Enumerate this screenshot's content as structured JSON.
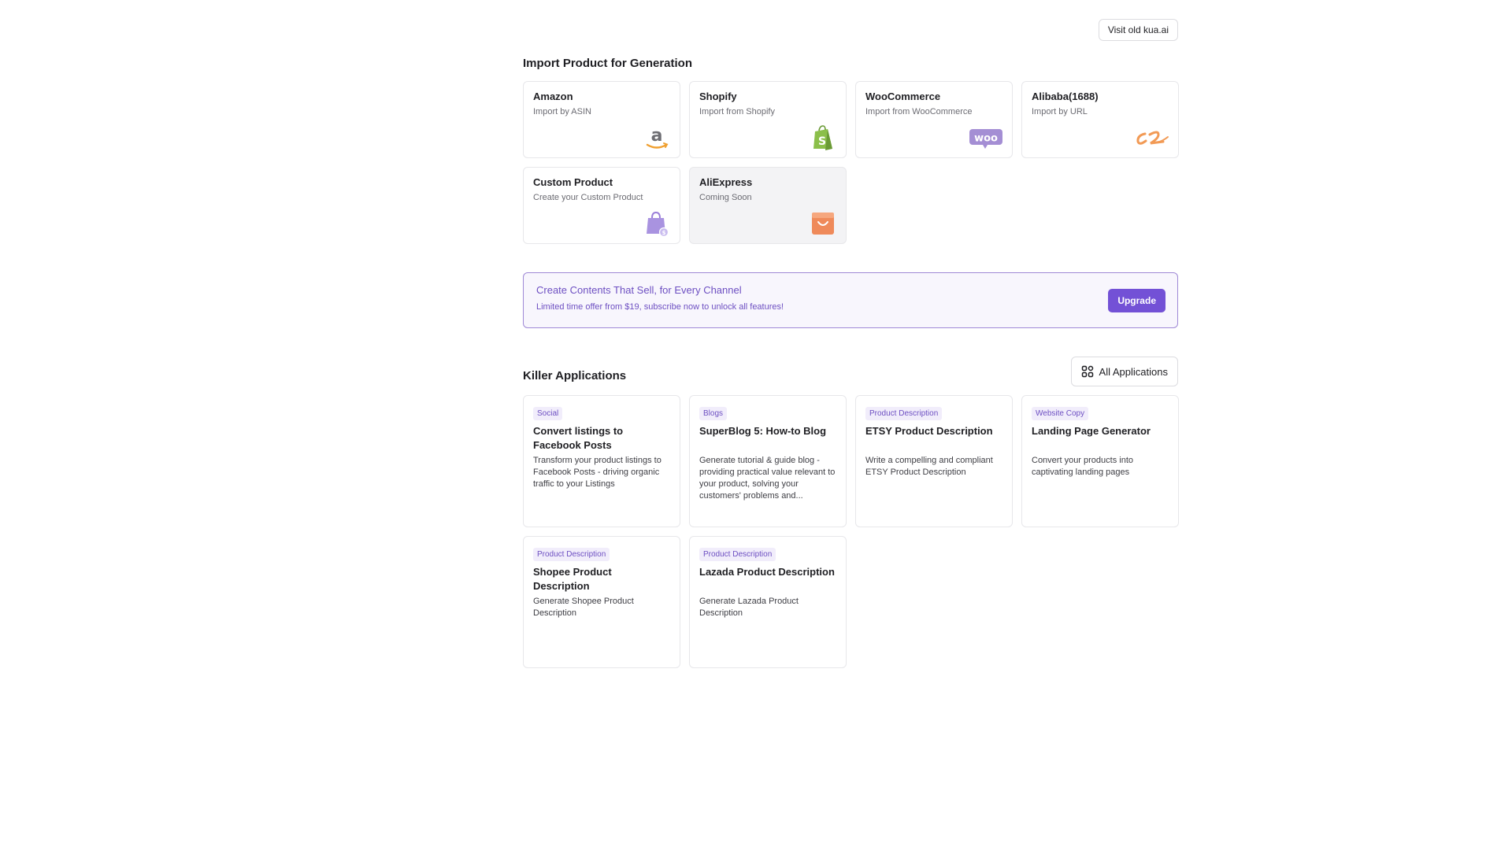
{
  "header": {
    "old_site_label": "Visit old kua.ai"
  },
  "import_section": {
    "title": "Import Product for Generation",
    "cards": [
      {
        "name": "Amazon",
        "desc": "Import by ASIN",
        "icon": "amazon-logo-icon"
      },
      {
        "name": "Shopify",
        "desc": "Import from Shopify",
        "icon": "shopify-logo-icon"
      },
      {
        "name": "WooCommerce",
        "desc": "Import from WooCommerce",
        "icon": "woocommerce-logo-icon"
      },
      {
        "name": "Alibaba(1688)",
        "desc": "Import by URL",
        "icon": "alibaba-logo-icon"
      },
      {
        "name": "Custom Product",
        "desc": "Create your Custom Product",
        "icon": "shopping-bag-icon"
      },
      {
        "name": "AliExpress",
        "desc": "Coming Soon",
        "icon": "aliexpress-logo-icon",
        "disabled": true
      }
    ]
  },
  "promo": {
    "title": "Create Contents That Sell, for Every Channel",
    "subtitle": "Limited time offer from $19, subscribe now to unlock all features!",
    "button": "Upgrade"
  },
  "killer_section": {
    "title": "Killer Applications",
    "all_button": "All Applications",
    "apps": [
      {
        "tag": "Social",
        "title": "Convert listings to Facebook Posts",
        "desc": "Transform your product listings to Facebook Posts - driving organic traffic to your Listings"
      },
      {
        "tag": "Blogs",
        "title": "SuperBlog 5: How-to Blog",
        "desc": "Generate tutorial & guide blog - providing practical value relevant to your product, solving your customers' problems and..."
      },
      {
        "tag": "Product Description",
        "title": "ETSY Product Description",
        "desc": "Write a compelling and compliant ETSY Product Description"
      },
      {
        "tag": "Website Copy",
        "title": "Landing Page Generator",
        "desc": "Convert your products into captivating landing pages"
      },
      {
        "tag": "Product Description",
        "title": "Shopee Product Description",
        "desc": "Generate Shopee Product Description"
      },
      {
        "tag": "Product Description",
        "title": "Lazada Product Description",
        "desc": "Generate Lazada Product Description"
      }
    ]
  },
  "colors": {
    "accent": "#7351d6",
    "promo_border": "#9f89d6",
    "card_border": "#e7e7ea"
  }
}
